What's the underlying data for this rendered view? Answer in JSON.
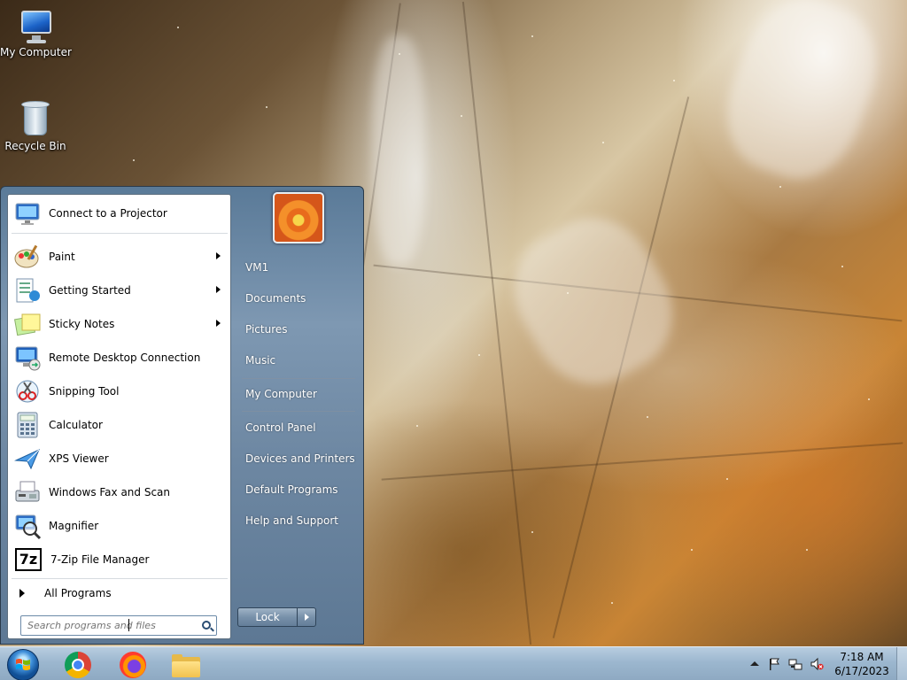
{
  "desktop": {
    "icons": [
      {
        "label": "My Computer",
        "icon": "my-computer-icon"
      },
      {
        "label": "Recycle Bin",
        "icon": "recycle-bin-icon"
      }
    ]
  },
  "start_menu": {
    "programs": [
      {
        "label": "Connect to a Projector",
        "icon": "projector-icon",
        "submenu": false
      },
      {
        "label": "Paint",
        "icon": "paint-icon",
        "submenu": true
      },
      {
        "label": "Getting Started",
        "icon": "getting-started-icon",
        "submenu": true
      },
      {
        "label": "Sticky Notes",
        "icon": "sticky-notes-icon",
        "submenu": true
      },
      {
        "label": "Remote Desktop Connection",
        "icon": "remote-desktop-icon",
        "submenu": false
      },
      {
        "label": "Snipping Tool",
        "icon": "snipping-tool-icon",
        "submenu": false
      },
      {
        "label": "Calculator",
        "icon": "calculator-icon",
        "submenu": false
      },
      {
        "label": "XPS Viewer",
        "icon": "xps-viewer-icon",
        "submenu": false
      },
      {
        "label": "Windows Fax and Scan",
        "icon": "fax-scan-icon",
        "submenu": false
      },
      {
        "label": "Magnifier",
        "icon": "magnifier-icon",
        "submenu": false
      },
      {
        "label": "7-Zip File Manager",
        "icon": "7zip-icon",
        "submenu": false
      }
    ],
    "all_programs": "All Programs",
    "search_placeholder": "Search programs and files",
    "right_items": [
      {
        "label": "VM1"
      },
      {
        "label": "Documents"
      },
      {
        "label": "Pictures"
      },
      {
        "label": "Music"
      },
      {
        "label": "My Computer"
      },
      {
        "label": "Control Panel"
      },
      {
        "label": "Devices and Printers"
      },
      {
        "label": "Default Programs"
      },
      {
        "label": "Help and Support"
      }
    ],
    "lock_label": "Lock",
    "seven_zip_glyph": "7z"
  },
  "taskbar": {
    "pinned": [
      {
        "name": "chrome-icon"
      },
      {
        "name": "firefox-icon"
      },
      {
        "name": "file-explorer-icon"
      }
    ],
    "tray": {
      "time": "7:18 AM",
      "date": "6/17/2023"
    }
  },
  "colors": {
    "taskbar": "#9cb7cf",
    "start_menu_right": "#7e98b2",
    "start_menu_left": "#ffffff"
  }
}
